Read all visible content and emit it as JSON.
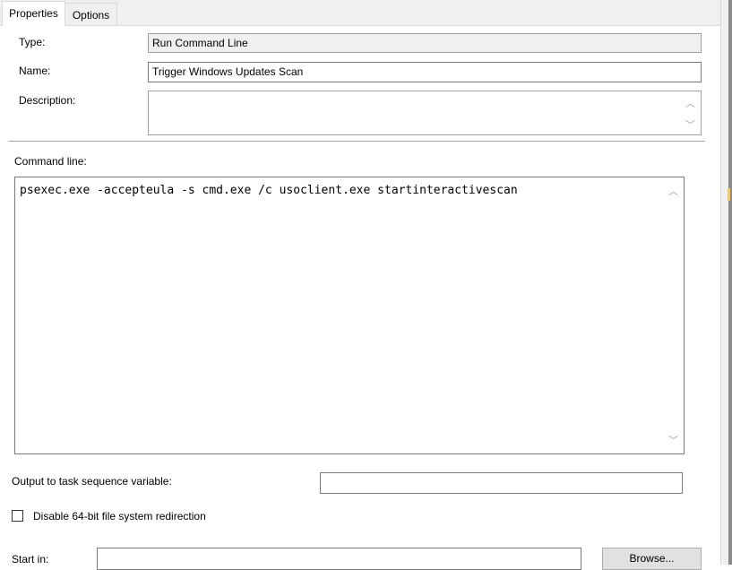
{
  "tabs": [
    {
      "label": "Properties",
      "active": true
    },
    {
      "label": "Options",
      "active": false
    }
  ],
  "type": {
    "label": "Type:",
    "value": "Run Command Line"
  },
  "name": {
    "label": "Name:",
    "value": "Trigger Windows Updates Scan"
  },
  "description": {
    "label": "Description:",
    "value": ""
  },
  "command_line": {
    "label": "Command line:",
    "value": "psexec.exe -accepteula -s cmd.exe /c usoclient.exe startinteractivescan"
  },
  "output_variable": {
    "label": "Output to task sequence variable:",
    "value": ""
  },
  "disable_redirection": {
    "label": "Disable 64-bit file system redirection",
    "checked": false
  },
  "start_in": {
    "label": "Start in:",
    "value": "",
    "browse_label": "Browse..."
  },
  "icons": {
    "scroll_up": "chevron-up-icon",
    "scroll_down": "chevron-down-icon"
  }
}
